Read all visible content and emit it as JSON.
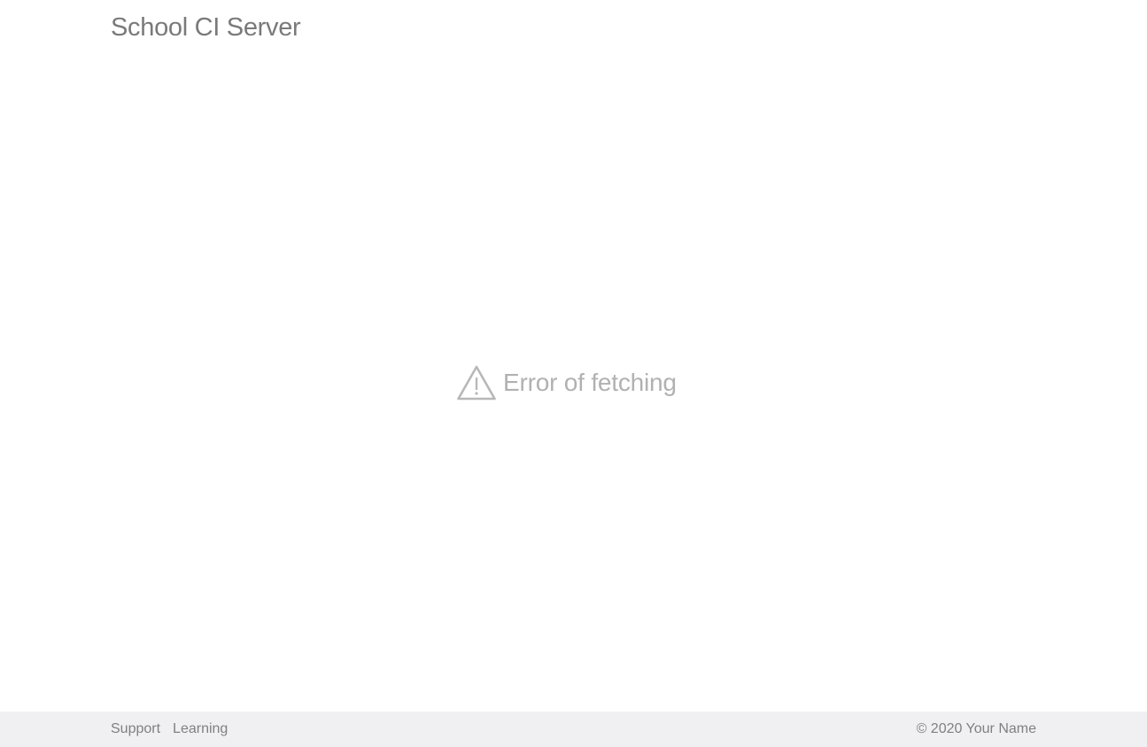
{
  "header": {
    "title": "School CI Server"
  },
  "main": {
    "error_icon": "warning-triangle-icon",
    "error_message": "Error of fetching",
    "error_color": "#b1b1b1"
  },
  "footer": {
    "links": [
      {
        "label": "Support"
      },
      {
        "label": "Learning"
      }
    ],
    "copyright": "© 2020 Your Name",
    "background": "#f0f0f2"
  }
}
